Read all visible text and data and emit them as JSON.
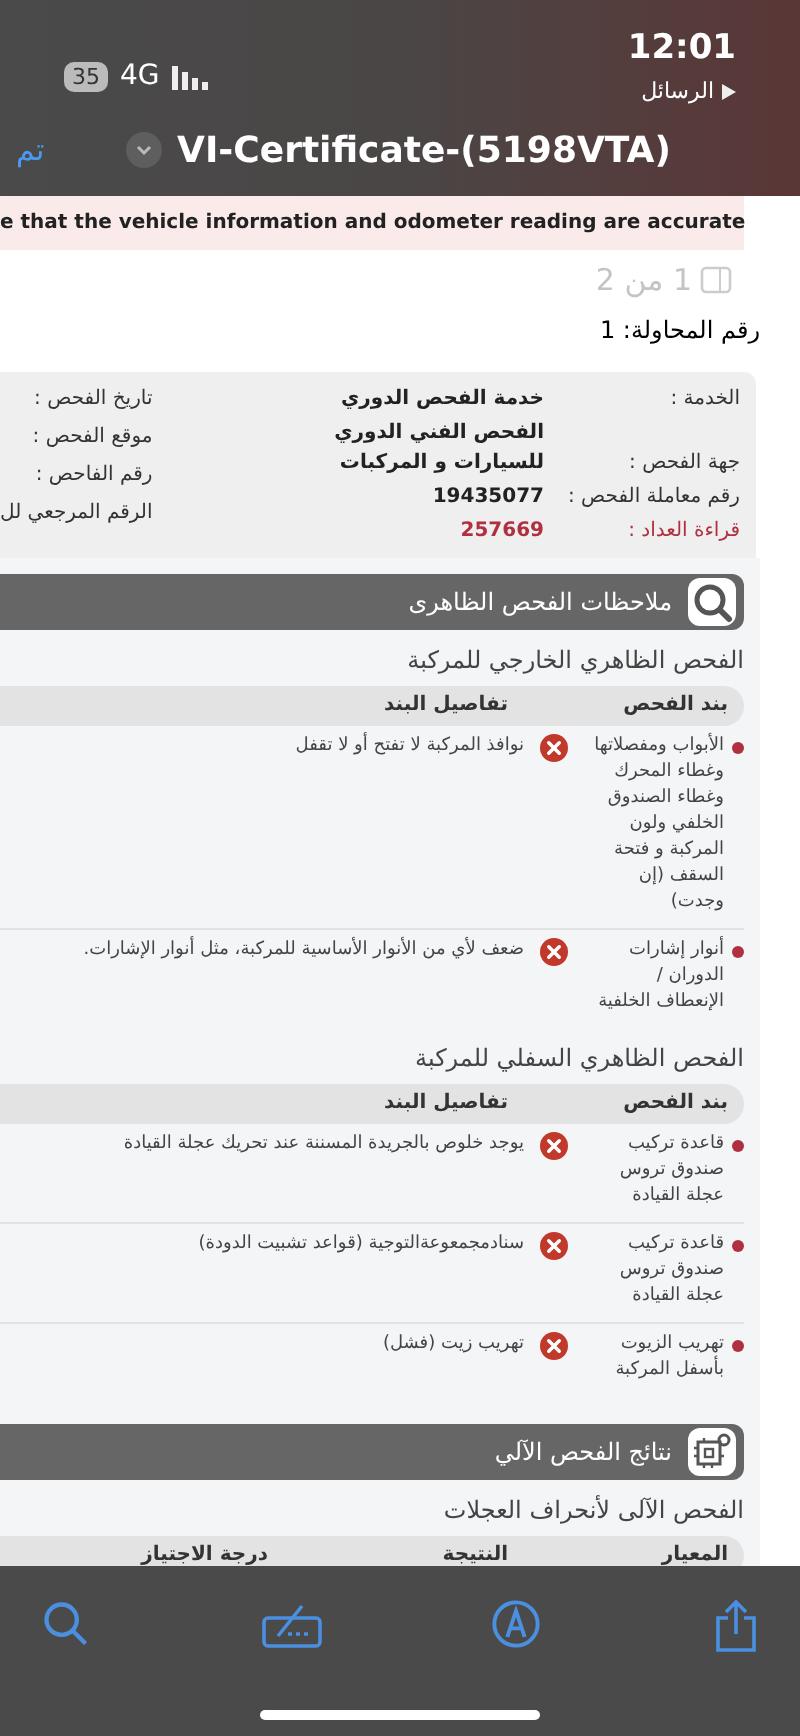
{
  "status_bar": {
    "time": "12:01",
    "back_label": "الرسائل",
    "battery": "35",
    "network": "4G"
  },
  "nav": {
    "done": "تم",
    "title": "VI-Certificate-(5198VTA)"
  },
  "banner": "e that the vehicle information and odometer reading are accurate",
  "page_indicator": "1 من 2",
  "attempt": "رقم المحاولة: 1",
  "info": {
    "rows": [
      {
        "label": "الخدمة :",
        "value": "خدمة الفحص الدوري",
        "highlighted": false
      },
      {
        "label": "جهة الفحص :",
        "value": "الفحص الفني الدوري للسيارات و المركبات",
        "highlighted": false
      },
      {
        "label": "رقم معاملة الفحص :",
        "value": "19435077",
        "highlighted": false
      },
      {
        "label": "قراءة العداد :",
        "value": "257669",
        "highlighted": true
      }
    ],
    "side_labels": [
      "تاريخ الفحص :",
      "موقع الفحص :",
      "رقم الفاحص :",
      "الرقم المرجعي لل"
    ]
  },
  "sections": [
    {
      "kind": "visual",
      "title": "ملاحظات الفحص الظاهرى",
      "groups": [
        {
          "title": "الفحص الظاهري الخارجي للمركبة",
          "columns": [
            "بند الفحص",
            "تفاصيل البند"
          ],
          "rows": [
            {
              "item": "الأبواب ومفصلاتها وغطاء المحرك وغطاء الصندوق الخلفي ولون المركبة و فتحة السقف (إن وجدت)",
              "failed": true,
              "detail": "نوافذ المركبة لا تفتح أو لا تقفل"
            },
            {
              "item": "أنوار إشارات الدوران / الإنعطاف الخلفية",
              "failed": true,
              "detail": "ضعف لأي من الأنوار الأساسية للمركبة، مثل أنوار الإشارات."
            }
          ]
        },
        {
          "title": "الفحص الظاهري السفلي للمركبة",
          "columns": [
            "بند الفحص",
            "تفاصيل البند"
          ],
          "rows": [
            {
              "item": "قاعدة تركيب صندوق تروس عجلة القيادة",
              "failed": true,
              "detail": "يوجد خلوص بالجريدة المسننة عند تحريك عجلة القيادة"
            },
            {
              "item": "قاعدة تركيب صندوق تروس عجلة القيادة",
              "failed": true,
              "detail": "سنادمجمعوعةالتوجية (قواعد تشبيت الدودة)"
            },
            {
              "item": "تهريب الزيوت بأسفل المركبة",
              "failed": true,
              "detail": "تهريب زيت (فشل)"
            }
          ]
        }
      ]
    },
    {
      "kind": "automated",
      "title": "نتائج الفحص الآلي",
      "groups": [
        {
          "title": "الفحص الآلى لأنحراف العجلات",
          "columns": [
            "المعيار",
            "النتيجة",
            "درجة الاجتياز"
          ]
        }
      ]
    }
  ]
}
